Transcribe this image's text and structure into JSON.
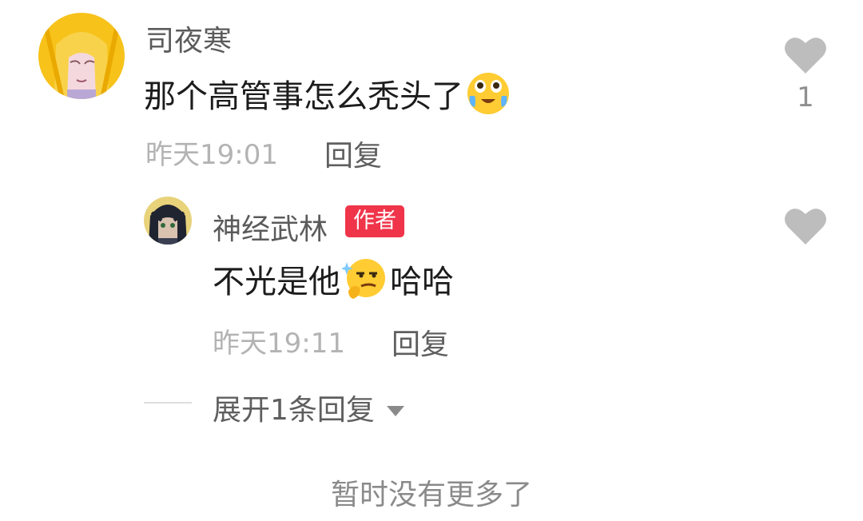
{
  "comment": {
    "username": "司夜寒",
    "text_before_emoji": "那个高管事怎么秃头了",
    "emoji_icon": "laugh-cry-emoji",
    "time": "昨天19:01",
    "reply_label": "回复",
    "like_count": "1"
  },
  "reply": {
    "username": "神经武林",
    "badge": "作者",
    "text_before_emoji": "不光是他",
    "emoji_icon": "smirk-thinking-emoji",
    "text_after_emoji": "哈哈",
    "time": "昨天19:11",
    "reply_label": "回复"
  },
  "expand": {
    "label": "展开1条回复"
  },
  "footer": {
    "no_more": "暂时没有更多了"
  },
  "colors": {
    "badge": "#f0344a",
    "heart": "#bdbdbd",
    "meta": "#b3b3b3"
  }
}
